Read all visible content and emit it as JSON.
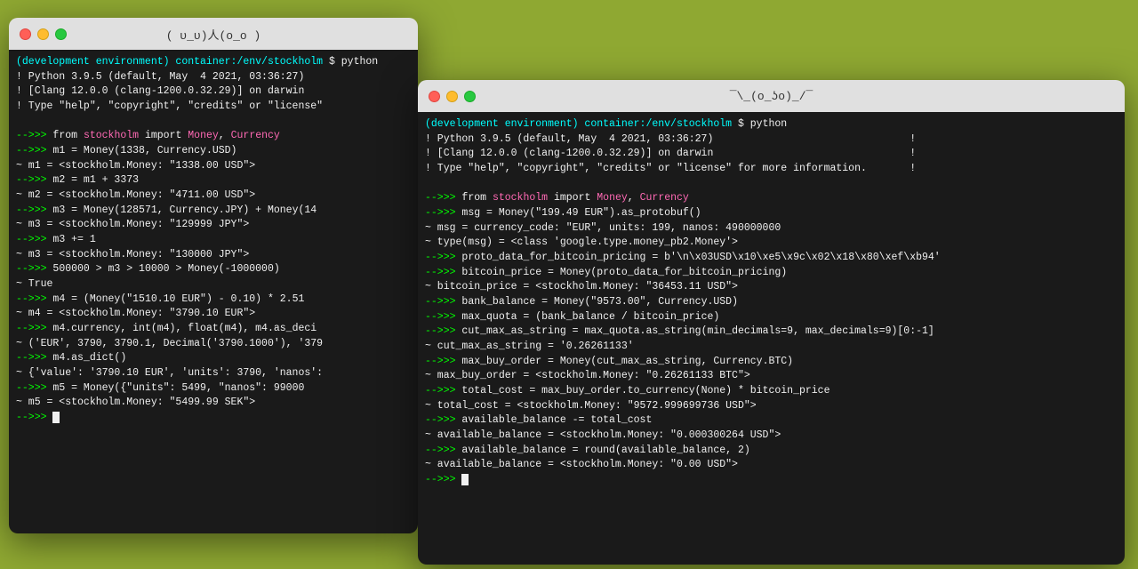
{
  "background_color": "#8fa832",
  "window1": {
    "title": "( υ_υ)人(ο_ο )",
    "prompt": "(development environment) container:/env/stockholm $ python",
    "lines": []
  },
  "window2": {
    "title": "¯\\_(ο_ʖο)_/¯",
    "prompt": "(development environment) container:/env/stockholm $ python",
    "lines": []
  }
}
